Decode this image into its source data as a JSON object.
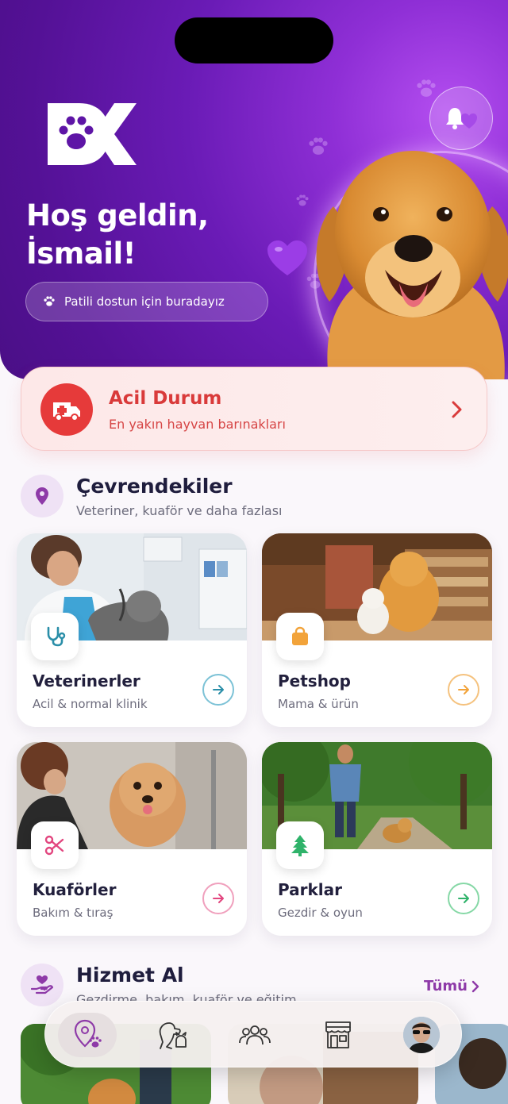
{
  "hero": {
    "greeting": "Hoş geldin,",
    "name": "İsmail!",
    "tagline": "Patili dostun için buradayız",
    "brand_color": "#6a1bb6",
    "icons": [
      "paw-logo-icon",
      "bell-icon",
      "heart-icon",
      "paw-icon"
    ]
  },
  "emergency": {
    "title": "Acil Durum",
    "subtitle": "En yakın hayvan barınakları",
    "accent": "#e63a3a",
    "icon": "ambulance-icon"
  },
  "nearby": {
    "title": "Çevrendekiler",
    "subtitle": "Veteriner, kuaför ve daha fazlası",
    "icon": "location-pin-icon",
    "cards": [
      {
        "title": "Veterinerler",
        "subtitle": "Acil & normal klinik",
        "icon": "stethoscope-icon",
        "accent": "#2a8ea8"
      },
      {
        "title": "Petshop",
        "subtitle": "Mama & ürün",
        "icon": "shopping-bag-icon",
        "accent": "#f2a33a"
      },
      {
        "title": "Kuaförler",
        "subtitle": "Bakım & tıraş",
        "icon": "scissors-icon",
        "accent": "#e2467f"
      },
      {
        "title": "Parklar",
        "subtitle": "Gezdir & oyun",
        "icon": "tree-icon",
        "accent": "#2fb36a"
      }
    ]
  },
  "services": {
    "title": "Hizmet Al",
    "subtitle": "Gezdirme, bakım, kuaför ve eğitim",
    "see_all": "Tümü",
    "icon": "hand-heart-icon"
  },
  "bottom_nav": {
    "items": [
      "map-paw-icon",
      "pets-icon",
      "community-icon",
      "store-icon",
      "profile-avatar"
    ],
    "active": 0
  }
}
